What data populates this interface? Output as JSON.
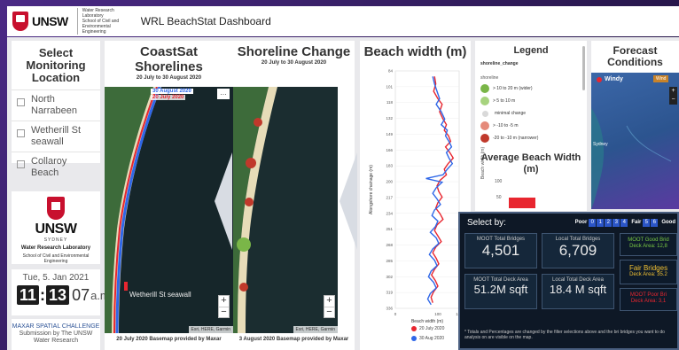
{
  "header": {
    "logo_text": "UNSW",
    "lab_name": "Water Research Laboratory",
    "lab_school": "School of Civil and Environmental Engineering",
    "title": "WRL BeachStat Dashboard"
  },
  "select_panel": {
    "title": "Select Monitoring Location",
    "locations": [
      {
        "label": "North Narrabeen"
      },
      {
        "label": "Wetherill St seawall"
      },
      {
        "label": "Collaroy Beach"
      }
    ]
  },
  "logo_panel": {
    "unsw": "UNSW",
    "sydney": "SYDNEY",
    "lab": "Water Research Laboratory",
    "school": "School of Civil and Environmental Engineering"
  },
  "clock": {
    "date": "Tue, 5. Jan 2021",
    "hours": "11",
    "minutes": "13",
    "seconds": "07",
    "ampm": "a.m."
  },
  "maxar": {
    "line1": "MAXAR SPATIAL CHALLENGE",
    "line2": "Submission by The UNSW Water Research"
  },
  "coastsat": {
    "title": "CoastSat Shorelines",
    "subtitle": "20 July to 30 August 2020",
    "label_aug": "30 August 2020",
    "label_jul": "20 July 2020",
    "seawall_label": "Wetherill St seawall",
    "caption": "20 July 2020 Basemap provided by Maxar",
    "attribution": "Esri, HERE, Garmin",
    "zoom_in": "+",
    "zoom_out": "−",
    "more": "…"
  },
  "shoreline_change": {
    "title": "Shoreline Change",
    "subtitle": "20 July to 30 August 2020",
    "caption": "3 August 2020 Basemap provided by Maxar",
    "attribution": "Esri, HERE, Garmin",
    "zoom_in": "+",
    "zoom_out": "−"
  },
  "beach_width": {
    "title": "Beach width (m)",
    "legend": [
      {
        "label": "20 July 2020",
        "color": "#e8262f"
      },
      {
        "label": "30 Aug 2020",
        "color": "#2f67e8"
      }
    ]
  },
  "chart_data": {
    "type": "line",
    "orientation": "vertical-profile",
    "xlabel": "Beach width (m)",
    "ylabel": "Alongshore chainage (m)",
    "xlim": [
      0,
      150
    ],
    "x_ticks": [
      "0",
      "100",
      "150"
    ],
    "y_ticks": [
      "84",
      "101",
      "118",
      "132",
      "149",
      "166",
      "183",
      "200",
      "217",
      "234",
      "251",
      "268",
      "285",
      "302",
      "319",
      "336"
    ],
    "ylim": [
      84,
      340
    ],
    "series": [
      {
        "name": "20 July 2020",
        "color": "#e8262f",
        "points": [
          [
            92,
            90
          ],
          [
            95,
            98
          ],
          [
            90,
            106
          ],
          [
            100,
            114
          ],
          [
            110,
            120
          ],
          [
            104,
            128
          ],
          [
            112,
            136
          ],
          [
            120,
            142
          ],
          [
            115,
            148
          ],
          [
            125,
            154
          ],
          [
            130,
            160
          ],
          [
            118,
            166
          ],
          [
            128,
            172
          ],
          [
            136,
            178
          ],
          [
            124,
            184
          ],
          [
            115,
            190
          ],
          [
            120,
            196
          ],
          [
            105,
            202
          ],
          [
            98,
            208
          ],
          [
            102,
            214
          ],
          [
            110,
            220
          ],
          [
            100,
            226
          ],
          [
            95,
            232
          ],
          [
            105,
            238
          ],
          [
            112,
            244
          ],
          [
            98,
            250
          ],
          [
            92,
            256
          ],
          [
            100,
            262
          ],
          [
            108,
            268
          ],
          [
            95,
            274
          ],
          [
            88,
            280
          ],
          [
            96,
            286
          ],
          [
            102,
            292
          ],
          [
            92,
            298
          ],
          [
            85,
            304
          ],
          [
            94,
            310
          ],
          [
            100,
            316
          ],
          [
            90,
            322
          ],
          [
            84,
            328
          ],
          [
            88,
            334
          ]
        ]
      },
      {
        "name": "30 Aug 2020",
        "color": "#2f67e8",
        "points": [
          [
            88,
            90
          ],
          [
            92,
            98
          ],
          [
            98,
            106
          ],
          [
            104,
            114
          ],
          [
            96,
            120
          ],
          [
            108,
            128
          ],
          [
            116,
            136
          ],
          [
            108,
            142
          ],
          [
            122,
            148
          ],
          [
            118,
            154
          ],
          [
            126,
            160
          ],
          [
            132,
            166
          ],
          [
            120,
            172
          ],
          [
            126,
            178
          ],
          [
            134,
            184
          ],
          [
            122,
            190
          ],
          [
            112,
            196
          ],
          [
            72,
            200
          ],
          [
            110,
            204
          ],
          [
            96,
            210
          ],
          [
            88,
            216
          ],
          [
            98,
            222
          ],
          [
            106,
            228
          ],
          [
            92,
            234
          ],
          [
            86,
            240
          ],
          [
            100,
            246
          ],
          [
            94,
            252
          ],
          [
            82,
            258
          ],
          [
            96,
            264
          ],
          [
            102,
            270
          ],
          [
            88,
            276
          ],
          [
            80,
            282
          ],
          [
            92,
            288
          ],
          [
            98,
            294
          ],
          [
            84,
            300
          ],
          [
            78,
            306
          ],
          [
            90,
            312
          ],
          [
            96,
            318
          ],
          [
            82,
            324
          ],
          [
            76,
            330
          ],
          [
            84,
            336
          ]
        ]
      }
    ]
  },
  "legend_panel": {
    "title": "Legend",
    "layer": "shoreline_change",
    "group": "shoreline",
    "items": [
      {
        "label": "> 10 to 20 m (wider)",
        "color": "#7ab648"
      },
      {
        "label": "> 5 to 10 m",
        "color": "#a7d37e"
      },
      {
        "label": "minimal change",
        "color": "#d9d9d9"
      },
      {
        "label": "> -10 to -5 m",
        "color": "#e58a7a"
      },
      {
        "label": "-20 to -10 m (narrower)",
        "color": "#c0392b"
      }
    ]
  },
  "avg_width": {
    "title": "Average Beach Width (m)",
    "ylabel": "Beach width (m)",
    "ticks": [
      "100",
      "50"
    ]
  },
  "forecast": {
    "title": "Forecast Conditions",
    "map_brand": "Windy",
    "badge": "Wind",
    "place": "Sydney"
  },
  "bridges": {
    "title": "Select by:",
    "filter_poor": "Poor",
    "filter_fair": "Fair",
    "filter_good": "Good",
    "chips_poor": [
      "0",
      "1",
      "2",
      "3",
      "4"
    ],
    "chips_fair": [
      "5",
      "6"
    ],
    "moot_total_label": "MOOT Total Bridges",
    "moot_total_value": "4,501",
    "local_total_label": "Local Total Bridges",
    "local_total_value": "6,709",
    "moot_deck_label": "MOOT Total Deck Area",
    "moot_deck_value": "51.2M sqft",
    "local_deck_label": "Local Total Deck Area",
    "local_deck_value": "18.4 M sqft",
    "good_label": "MOOT Good Brid",
    "good_sub": "Deck Area: 12,8",
    "fair_label": "Fair Bridges",
    "fair_sub": "Deck Area: 35.2",
    "poor_label": "MOOT Poor Bri",
    "poor_sub": "Deck Area: 3,1",
    "note": "* Totals and Percentages are changed by the filter selections above and the bri bridges you want to do analysis on are visible on the map."
  }
}
